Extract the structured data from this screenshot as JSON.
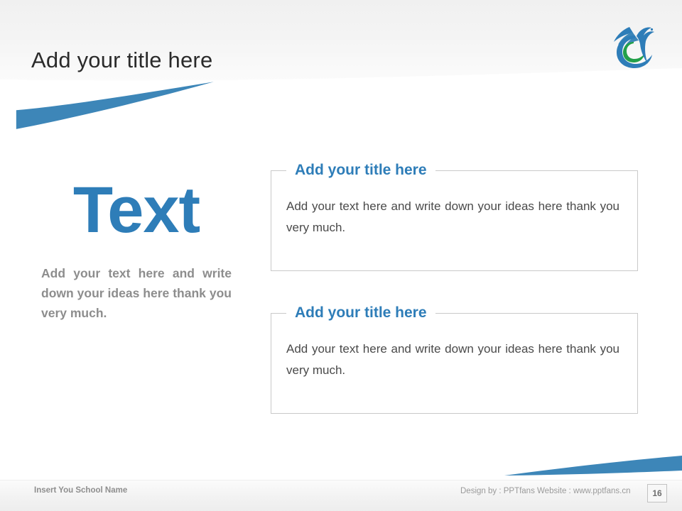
{
  "slide": {
    "title": "Add your title here",
    "logo_name": "swan-logo"
  },
  "left_column": {
    "headline": "Text",
    "paragraph": "Add your text here and write down your ideas here thank you very much."
  },
  "content_boxes": [
    {
      "title": "Add your title here",
      "body": "Add your text here and write down your ideas here thank you very much."
    },
    {
      "title": "Add your title here",
      "body": "Add your text here and write down your ideas here thank you very much."
    }
  ],
  "footer": {
    "school_name": "Insert You School Name",
    "credit": "Design by : PPTfans  Website : www.pptfans.cn",
    "page_number": "16"
  },
  "colors": {
    "accent_blue": "#2e7db8",
    "swoosh_blue": "#3d86b8",
    "logo_green": "#23a04a",
    "title_gray": "#2b2b2b",
    "body_gray": "#4a4a4a",
    "muted_gray": "#8d8d8d",
    "border_gray": "#c9c9c9"
  }
}
